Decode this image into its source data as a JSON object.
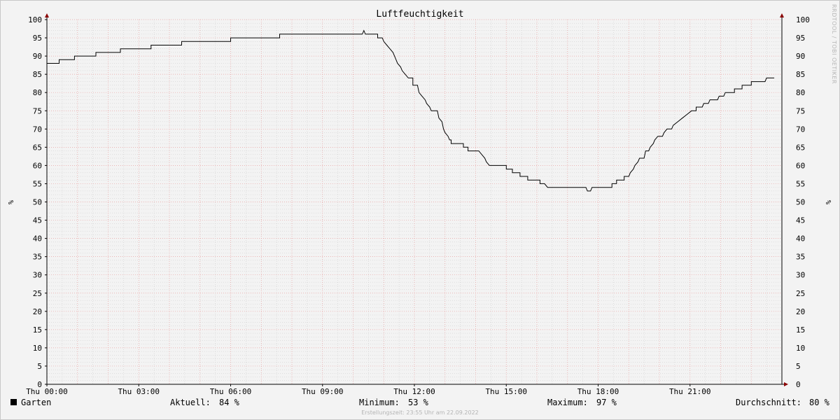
{
  "chart_data": {
    "type": "line",
    "title": "Luftfeuchtigkeit",
    "ylabel": "%",
    "ylim": [
      0,
      100
    ],
    "ytick_step": 5,
    "x_ticks": [
      "Thu 00:00",
      "Thu 03:00",
      "Thu 06:00",
      "Thu 09:00",
      "Thu 12:00",
      "Thu 15:00",
      "Thu 18:00",
      "Thu 21:00"
    ],
    "x_range_hours": [
      0,
      24
    ],
    "grid": true,
    "series": [
      {
        "name": "Garten",
        "color": "#000000",
        "points": [
          [
            0.0,
            88
          ],
          [
            0.4,
            88
          ],
          [
            0.4,
            89
          ],
          [
            0.9,
            89
          ],
          [
            0.9,
            90
          ],
          [
            1.6,
            90
          ],
          [
            1.6,
            91
          ],
          [
            2.4,
            91
          ],
          [
            2.4,
            92
          ],
          [
            3.4,
            92
          ],
          [
            3.4,
            93
          ],
          [
            4.4,
            93
          ],
          [
            4.4,
            94
          ],
          [
            6.0,
            94
          ],
          [
            6.0,
            95
          ],
          [
            7.6,
            95
          ],
          [
            7.6,
            96
          ],
          [
            10.3,
            96
          ],
          [
            10.35,
            97
          ],
          [
            10.4,
            96
          ],
          [
            10.8,
            96
          ],
          [
            10.8,
            95
          ],
          [
            10.95,
            95
          ],
          [
            11.0,
            94
          ],
          [
            11.1,
            93
          ],
          [
            11.2,
            92
          ],
          [
            11.3,
            91
          ],
          [
            11.35,
            90
          ],
          [
            11.45,
            88
          ],
          [
            11.55,
            87
          ],
          [
            11.6,
            86
          ],
          [
            11.7,
            85
          ],
          [
            11.8,
            84
          ],
          [
            11.95,
            84
          ],
          [
            11.95,
            82
          ],
          [
            12.1,
            82
          ],
          [
            12.15,
            80
          ],
          [
            12.25,
            79
          ],
          [
            12.35,
            78
          ],
          [
            12.4,
            77
          ],
          [
            12.5,
            76
          ],
          [
            12.55,
            75
          ],
          [
            12.75,
            75
          ],
          [
            12.8,
            73
          ],
          [
            12.9,
            72
          ],
          [
            12.95,
            70
          ],
          [
            13.0,
            69
          ],
          [
            13.1,
            68
          ],
          [
            13.15,
            67
          ],
          [
            13.2,
            67
          ],
          [
            13.2,
            66
          ],
          [
            13.6,
            66
          ],
          [
            13.6,
            65
          ],
          [
            13.75,
            65
          ],
          [
            13.75,
            64
          ],
          [
            14.1,
            64
          ],
          [
            14.2,
            63
          ],
          [
            14.3,
            62
          ],
          [
            14.35,
            61
          ],
          [
            14.45,
            60
          ],
          [
            15.0,
            60
          ],
          [
            15.0,
            59
          ],
          [
            15.2,
            59
          ],
          [
            15.2,
            58
          ],
          [
            15.45,
            58
          ],
          [
            15.45,
            57
          ],
          [
            15.7,
            57
          ],
          [
            15.7,
            56
          ],
          [
            16.1,
            56
          ],
          [
            16.1,
            55
          ],
          [
            16.25,
            55
          ],
          [
            16.35,
            54
          ],
          [
            17.6,
            54
          ],
          [
            17.65,
            53
          ],
          [
            17.75,
            53
          ],
          [
            17.8,
            54
          ],
          [
            18.45,
            54
          ],
          [
            18.45,
            55
          ],
          [
            18.6,
            55
          ],
          [
            18.6,
            56
          ],
          [
            18.85,
            56
          ],
          [
            18.85,
            57
          ],
          [
            19.0,
            57
          ],
          [
            19.05,
            58
          ],
          [
            19.15,
            59
          ],
          [
            19.2,
            60
          ],
          [
            19.3,
            61
          ],
          [
            19.35,
            62
          ],
          [
            19.5,
            62
          ],
          [
            19.55,
            64
          ],
          [
            19.65,
            64
          ],
          [
            19.7,
            65
          ],
          [
            19.8,
            66
          ],
          [
            19.85,
            67
          ],
          [
            19.95,
            68
          ],
          [
            20.1,
            68
          ],
          [
            20.15,
            69
          ],
          [
            20.25,
            70
          ],
          [
            20.4,
            70
          ],
          [
            20.45,
            71
          ],
          [
            20.6,
            72
          ],
          [
            20.75,
            73
          ],
          [
            20.9,
            74
          ],
          [
            21.05,
            75
          ],
          [
            21.2,
            75
          ],
          [
            21.2,
            76
          ],
          [
            21.4,
            76
          ],
          [
            21.45,
            77
          ],
          [
            21.6,
            77
          ],
          [
            21.65,
            78
          ],
          [
            21.9,
            78
          ],
          [
            21.95,
            79
          ],
          [
            22.1,
            79
          ],
          [
            22.15,
            80
          ],
          [
            22.45,
            80
          ],
          [
            22.45,
            81
          ],
          [
            22.7,
            81
          ],
          [
            22.7,
            82
          ],
          [
            23.0,
            82
          ],
          [
            23.0,
            83
          ],
          [
            23.45,
            83
          ],
          [
            23.5,
            84
          ],
          [
            23.75,
            84
          ]
        ]
      }
    ]
  },
  "legend": {
    "series_name": "Garten",
    "current_label": "Aktuell:",
    "current_value": "84 %",
    "min_label": "Minimum:",
    "min_value": "53 %",
    "max_label": "Maximum:",
    "max_value": "97 %",
    "avg_label": "Durchschnitt:",
    "avg_value": "80 %"
  },
  "footer": "Erstellungszeit: 23:55 Uhr am 22.09.2022",
  "watermark": "RRDTOOL / TOBI OETIKER",
  "colors": {
    "axis": "#000000",
    "arrow": "#8b0000",
    "minor_grid": "#c8c8c8",
    "major_grid": "#e8a0a0"
  }
}
